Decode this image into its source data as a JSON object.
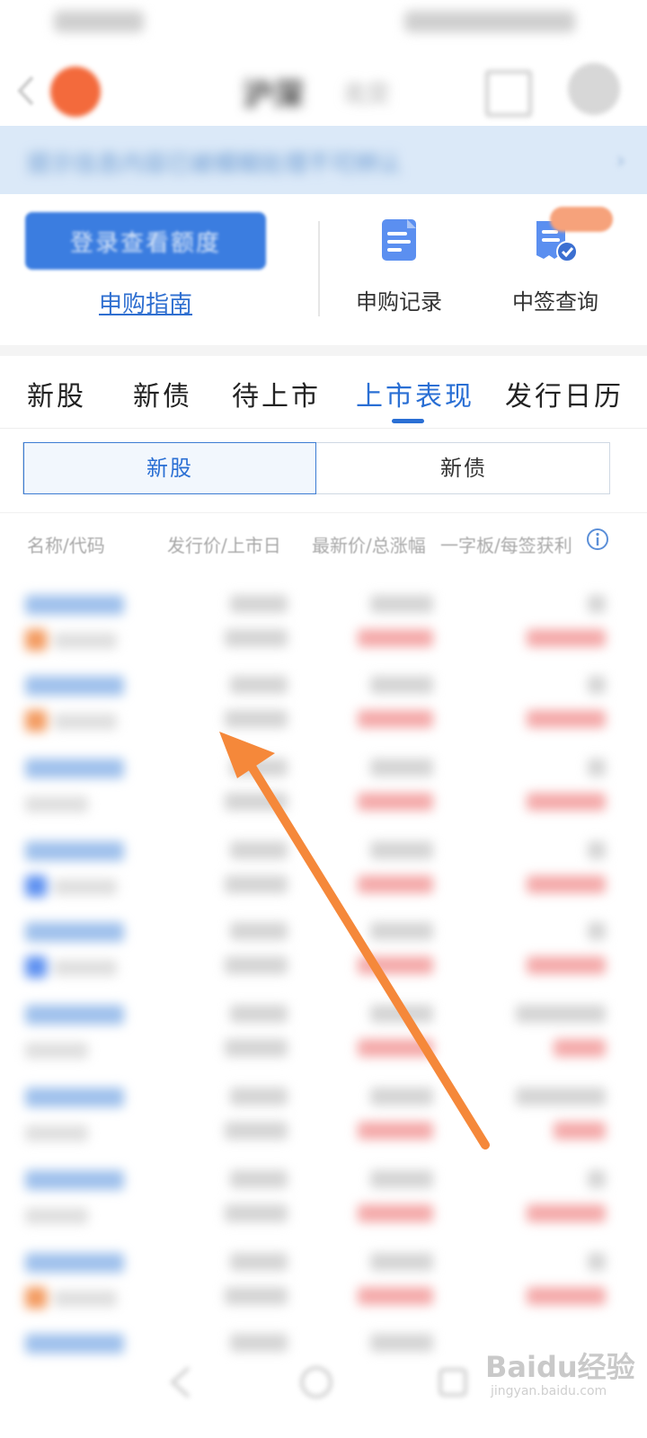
{
  "quick_panel": {
    "login_button_label": "登录查看额度",
    "guide_link": "申购指南",
    "items": [
      {
        "label": "申购记录",
        "icon": "document-icon"
      },
      {
        "label": "中签查询",
        "icon": "receipt-check-icon"
      }
    ]
  },
  "main_tabs": [
    {
      "label": "新股",
      "active": false
    },
    {
      "label": "新债",
      "active": false
    },
    {
      "label": "待上市",
      "active": false
    },
    {
      "label": "上市表现",
      "active": true
    },
    {
      "label": "发行日历",
      "active": false
    }
  ],
  "segment": {
    "options": [
      "新股",
      "新债"
    ],
    "selected": "新股"
  },
  "table": {
    "columns": [
      "名称/代码",
      "发行价/上市日",
      "最新价/总涨幅",
      "一字板/每签获利"
    ]
  },
  "watermark": {
    "main": "Baidu经验",
    "sub": "jingyan.baidu.com"
  },
  "colors": {
    "accent": "#2a6fd4",
    "login_button": "#3b7de0",
    "notice_bg": "#dbe9f8",
    "rise_red": "#e84a4a",
    "annotation_arrow": "#f5883a"
  }
}
